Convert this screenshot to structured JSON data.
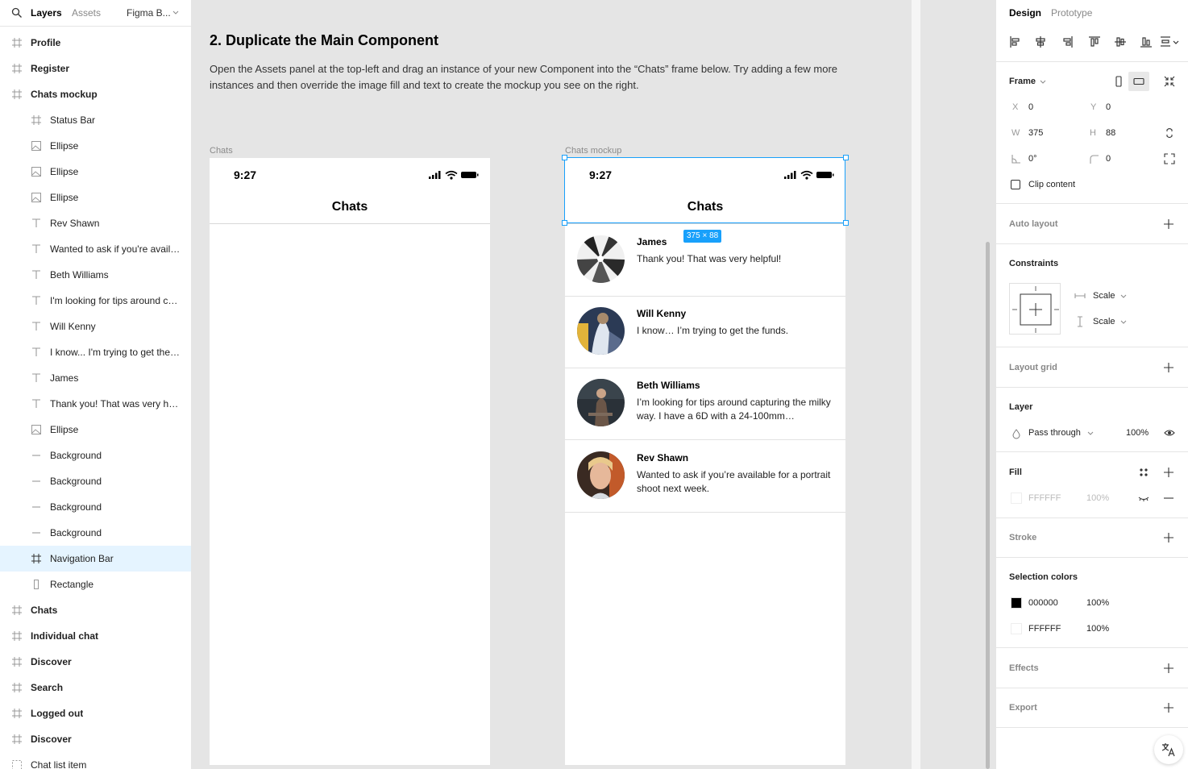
{
  "left_panel": {
    "tabs": {
      "layers": "Layers",
      "assets": "Assets",
      "page": "Figma B..."
    },
    "layers": [
      {
        "label": "Profile",
        "level": "top",
        "icon": "frame-icon"
      },
      {
        "label": "Register",
        "level": "top",
        "icon": "frame-icon"
      },
      {
        "label": "Chats mockup",
        "level": "top",
        "icon": "frame-icon"
      },
      {
        "label": "Status Bar",
        "level": "child",
        "icon": "frame-icon"
      },
      {
        "label": "Ellipse",
        "level": "child",
        "icon": "image-icon"
      },
      {
        "label": "Ellipse",
        "level": "child",
        "icon": "image-icon"
      },
      {
        "label": "Ellipse",
        "level": "child",
        "icon": "image-icon"
      },
      {
        "label": "Rev Shawn",
        "level": "child",
        "icon": "text-icon"
      },
      {
        "label": "Wanted to ask if you're available for a portrait shoot next week.",
        "level": "child",
        "icon": "text-icon"
      },
      {
        "label": "Beth Williams",
        "level": "child",
        "icon": "text-icon"
      },
      {
        "label": "I'm looking for tips around capturing the milky way.",
        "level": "child",
        "icon": "text-icon"
      },
      {
        "label": "Will Kenny",
        "level": "child",
        "icon": "text-icon"
      },
      {
        "label": "I know... I'm trying to get the funds.",
        "level": "child",
        "icon": "text-icon"
      },
      {
        "label": "James",
        "level": "child",
        "icon": "text-icon"
      },
      {
        "label": "Thank you! That was very helpful!",
        "level": "child",
        "icon": "text-icon"
      },
      {
        "label": "Ellipse",
        "level": "child",
        "icon": "image-icon"
      },
      {
        "label": "Background",
        "level": "child",
        "icon": "line-icon"
      },
      {
        "label": "Background",
        "level": "child",
        "icon": "line-icon"
      },
      {
        "label": "Background",
        "level": "child",
        "icon": "line-icon"
      },
      {
        "label": "Background",
        "level": "child",
        "icon": "line-icon"
      },
      {
        "label": "Navigation Bar",
        "level": "child",
        "icon": "frame-icon",
        "selected": true
      },
      {
        "label": "Rectangle",
        "level": "child",
        "icon": "rectangle-icon"
      },
      {
        "label": "Chats",
        "level": "top",
        "icon": "frame-icon"
      },
      {
        "label": "Individual chat",
        "level": "top",
        "icon": "frame-icon"
      },
      {
        "label": "Discover",
        "level": "top",
        "icon": "frame-icon"
      },
      {
        "label": "Search",
        "level": "top",
        "icon": "frame-icon"
      },
      {
        "label": "Logged out",
        "level": "top",
        "icon": "frame-icon"
      },
      {
        "label": "Discover",
        "level": "top",
        "icon": "frame-icon"
      },
      {
        "label": "Chat list item",
        "level": "component",
        "icon": "component-icon"
      }
    ]
  },
  "canvas": {
    "heading": "2. Duplicate the Main Component",
    "description": "Open the Assets panel at the top-left and drag an instance of your new Component into the “Chats” frame below. Try adding a few more instances and then override the image fill and text to create the mockup you see on the right.",
    "frame_left": {
      "label": "Chats",
      "time": "9:27",
      "title": "Chats"
    },
    "frame_right": {
      "label": "Chats mockup",
      "time": "9:27",
      "title": "Chats",
      "size_badge": "375 × 88",
      "chats": [
        {
          "name": "James",
          "message": "Thank you! That was very helpful!"
        },
        {
          "name": "Will Kenny",
          "message": "I know… I’m trying to get the funds."
        },
        {
          "name": "Beth Williams",
          "message": "I’m looking for tips around capturing the milky way. I have a 6D with a 24-100mm…"
        },
        {
          "name": "Rev Shawn",
          "message": "Wanted to ask if you’re available for a portrait shoot next week."
        }
      ]
    },
    "accent": "#18a0fb"
  },
  "right_panel": {
    "tabs": {
      "design": "Design",
      "prototype": "Prototype"
    },
    "frame": {
      "title": "Frame",
      "x_label": "X",
      "x": "0",
      "y_label": "Y",
      "y": "0",
      "w_label": "W",
      "w": "375",
      "h_label": "H",
      "h": "88",
      "rotation": "0°",
      "radius": "0",
      "clip_content": "Clip content"
    },
    "auto_layout": "Auto layout",
    "constraints": {
      "title": "Constraints",
      "horizontal": "Scale",
      "vertical": "Scale"
    },
    "layout_grid": "Layout grid",
    "layer": {
      "title": "Layer",
      "blend": "Pass through",
      "opacity": "100%"
    },
    "fill": {
      "title": "Fill",
      "hex": "FFFFFF",
      "opacity": "100%"
    },
    "stroke": "Stroke",
    "selection_colors": {
      "title": "Selection colors",
      "colors": [
        {
          "hex": "000000",
          "opacity": "100%",
          "swatch": "#000000"
        },
        {
          "hex": "FFFFFF",
          "opacity": "100%",
          "swatch": "#FFFFFF"
        }
      ]
    },
    "effects": "Effects",
    "export": "Export"
  }
}
